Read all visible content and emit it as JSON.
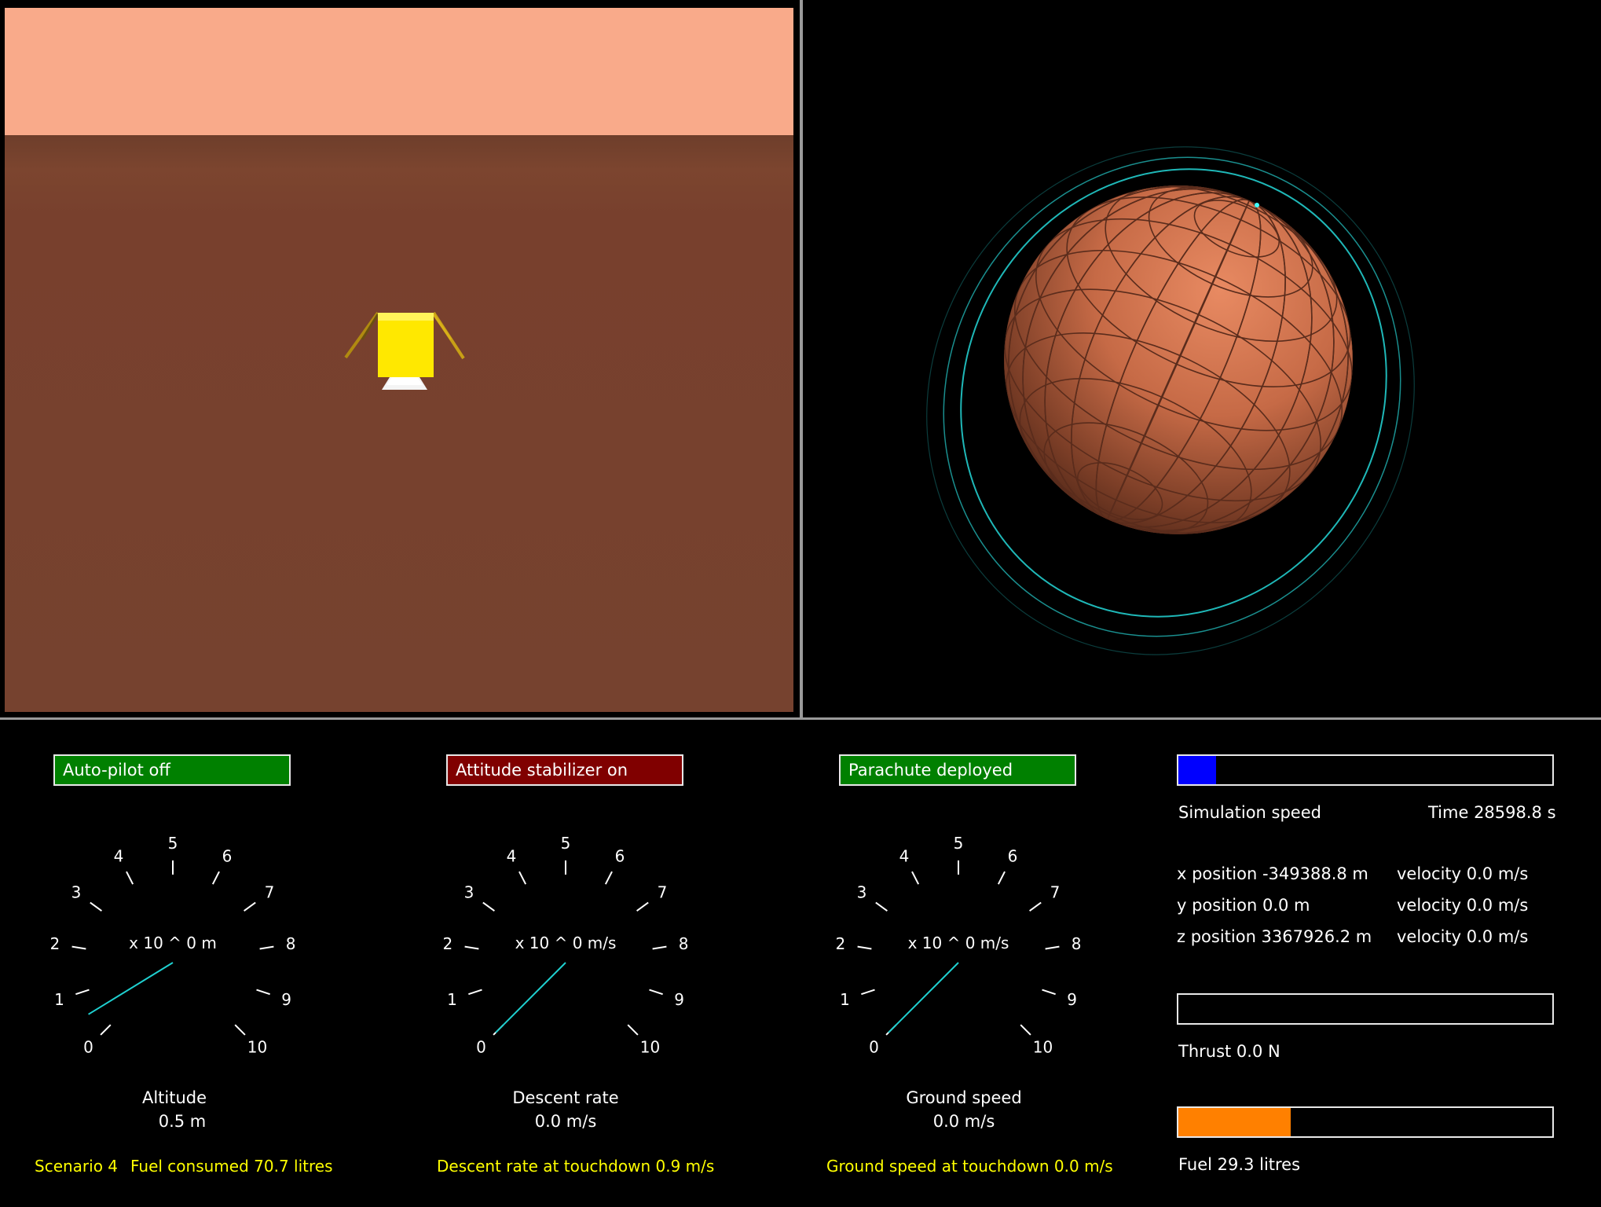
{
  "status": {
    "autopilot": "Auto-pilot off",
    "attitude": "Attitude stabilizer on",
    "parachute": "Parachute deployed"
  },
  "colors": {
    "green": "#008000",
    "red": "#800000",
    "sim_speed_fill": "#0000ff",
    "fuel_fill": "#ff8000",
    "sky": "#f9aa8a",
    "ground": "#7a4430",
    "lander": "#ffe800",
    "orbit": "#1fb8b8",
    "planet": "#d4704c"
  },
  "dials": [
    {
      "name": "Altitude",
      "scale": "x 10 ^ 0 m",
      "value_text": "0.5 m",
      "value": 0.5,
      "ticks": [
        "0",
        "1",
        "2",
        "3",
        "4",
        "5",
        "6",
        "7",
        "8",
        "9",
        "10"
      ]
    },
    {
      "name": "Descent rate",
      "scale": "x 10 ^ 0 m/s",
      "value_text": "0.0 m/s",
      "value": 0.0,
      "ticks": [
        "0",
        "1",
        "2",
        "3",
        "4",
        "5",
        "6",
        "7",
        "8",
        "9",
        "10"
      ]
    },
    {
      "name": "Ground speed",
      "scale": "x 10 ^ 0 m/s",
      "value_text": "0.0 m/s",
      "value": 0.0,
      "ticks": [
        "0",
        "1",
        "2",
        "3",
        "4",
        "5",
        "6",
        "7",
        "8",
        "9",
        "10"
      ]
    }
  ],
  "footer": {
    "scenario": "Scenario 4",
    "fuel_consumed": "Fuel consumed 70.7 litres",
    "descent_touchdown": "Descent rate at touchdown 0.9 m/s",
    "ground_touchdown": "Ground speed at touchdown 0.0 m/s"
  },
  "sim": {
    "speed_label": "Simulation speed",
    "speed_fraction": 0.1,
    "time": "Time 28598.8 s"
  },
  "positions": [
    {
      "pos": "x position -349388.8 m",
      "vel": "velocity 0.0 m/s"
    },
    {
      "pos": "y position 0.0 m",
      "vel": "velocity 0.0 m/s"
    },
    {
      "pos": "z position 3367926.2 m",
      "vel": "velocity 0.0 m/s"
    }
  ],
  "thrust": {
    "label": "Thrust 0.0 N",
    "fraction": 0.0
  },
  "fuel": {
    "label": "Fuel 29.3 litres",
    "fraction": 0.3
  }
}
